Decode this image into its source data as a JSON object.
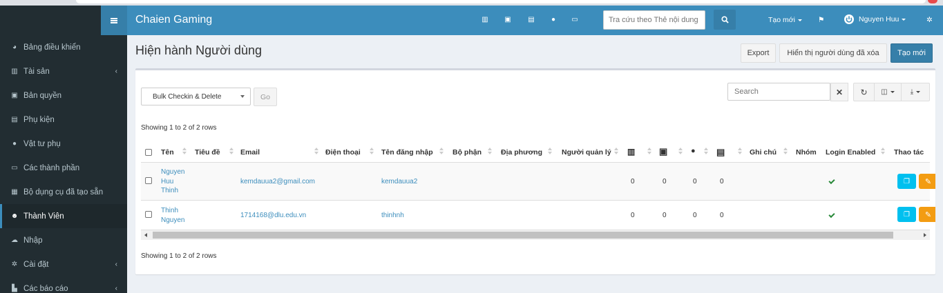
{
  "app": {
    "brand": "Chaien Gaming"
  },
  "topbar": {
    "search_placeholder": "Tra cứu theo Thẻ nội dung",
    "create_new": "Tạo mới",
    "user": "Nguyen Huu"
  },
  "sidebar": {
    "items": [
      {
        "label": "Bảng điều khiển",
        "icon": "dashboard-icon"
      },
      {
        "label": "Tài sản",
        "icon": "barcode-icon",
        "chevron": true
      },
      {
        "label": "Bản quyền",
        "icon": "floppy-disk-icon"
      },
      {
        "label": "Phụ kiện",
        "icon": "keyboard-icon"
      },
      {
        "label": "Vật tư phụ",
        "icon": "tint-icon"
      },
      {
        "label": "Các thành phần",
        "icon": "hdd-icon"
      },
      {
        "label": "Bộ dụng cụ đã tạo sẵn",
        "icon": "object-group-icon"
      },
      {
        "label": "Thành Viên",
        "icon": "users-icon",
        "active": true
      },
      {
        "label": "Nhập",
        "icon": "cloud-upload-icon"
      },
      {
        "label": "Cài đặt",
        "icon": "cog-icon",
        "chevron": true
      },
      {
        "label": "Các báo cáo",
        "icon": "chart-icon",
        "chevron": true
      }
    ]
  },
  "page": {
    "title": "Hiện hành Người dùng",
    "buttons": {
      "export": "Export",
      "show_deleted": "Hiển thị người dùng đã xóa",
      "create": "Tạo mới"
    }
  },
  "table": {
    "bulk_action": "Bulk Checkin & Delete",
    "go": "Go",
    "search_placeholder": "Search",
    "showing": "Showing 1 to 2 of 2 rows",
    "columns": {
      "name": "Tên",
      "title": "Tiêu đề",
      "email": "Email",
      "phone": "Điện thoại",
      "username": "Tên đăng nhập",
      "department": "Bộ phận",
      "location": "Địa phương",
      "manager": "Người quản lý",
      "notes": "Ghi chú",
      "groups": "Nhóm",
      "login_enabled": "Login Enabled",
      "actions": "Thao tác"
    },
    "rows": [
      {
        "name": "Nguyen Huu Thinh",
        "email": "kemdauua2@gmail.com",
        "username": "kemdauua2",
        "assets": "0",
        "licenses": "0",
        "consumables": "0",
        "accessories": "0",
        "login_enabled": true
      },
      {
        "name": "Thinh Nguyen",
        "email": "1714168@dlu.edu.vn",
        "username": "thinhnh",
        "assets": "0",
        "licenses": "0",
        "consumables": "0",
        "accessories": "0",
        "login_enabled": true
      }
    ]
  },
  "colors": {
    "primary": "#3c8dbc",
    "sidebar": "#222d32",
    "info": "#00c0ef",
    "warning": "#f39c12"
  }
}
